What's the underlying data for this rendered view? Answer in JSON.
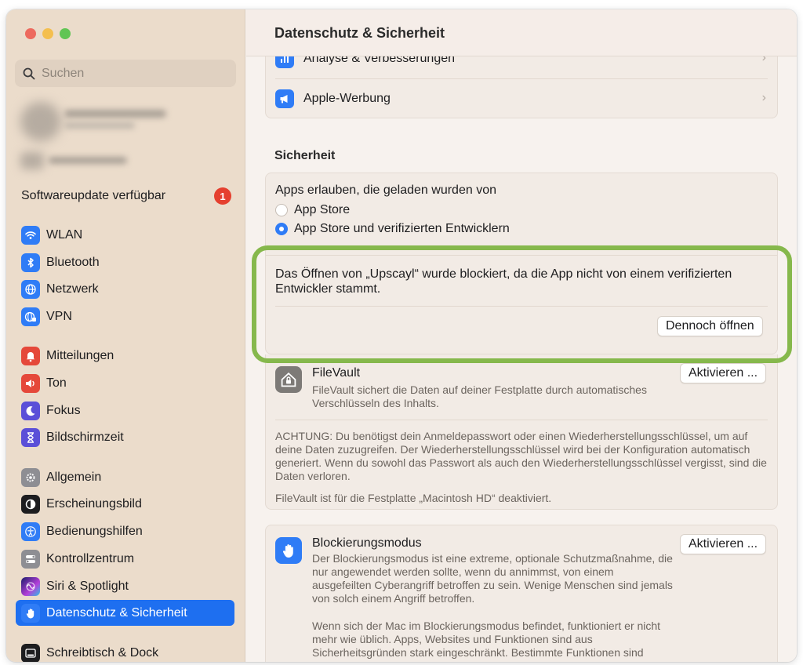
{
  "window": {
    "title": "Datenschutz & Sicherheit"
  },
  "search": {
    "placeholder": "Suchen"
  },
  "sidebar": {
    "update_label": "Softwareupdate verfügbar",
    "update_badge": "1",
    "items": [
      {
        "label": "WLAN",
        "icon": "wifi-icon",
        "color": "#2f7cf6"
      },
      {
        "label": "Bluetooth",
        "icon": "bluetooth-icon",
        "color": "#2f7cf6"
      },
      {
        "label": "Netzwerk",
        "icon": "globe-icon",
        "color": "#2f7cf6"
      },
      {
        "label": "VPN",
        "icon": "vpn-globe-icon",
        "color": "#2f7cf6"
      },
      {
        "label": "Mitteilungen",
        "icon": "bell-icon",
        "color": "#e5483a"
      },
      {
        "label": "Ton",
        "icon": "speaker-icon",
        "color": "#e5483a"
      },
      {
        "label": "Fokus",
        "icon": "moon-icon",
        "color": "#5b4fd8"
      },
      {
        "label": "Bildschirmzeit",
        "icon": "hourglass-icon",
        "color": "#5b4fd8"
      },
      {
        "label": "Allgemein",
        "icon": "gear-icon",
        "color": "#8e8e93"
      },
      {
        "label": "Erscheinungsbild",
        "icon": "appearance-icon",
        "color": "#1d1d1f"
      },
      {
        "label": "Bedienungshilfen",
        "icon": "accessibility-icon",
        "color": "#2f7cf6"
      },
      {
        "label": "Kontrollzentrum",
        "icon": "toggles-icon",
        "color": "#8e8e93"
      },
      {
        "label": "Siri & Spotlight",
        "icon": "siri-icon",
        "color": "#6a3fd1"
      },
      {
        "label": "Datenschutz & Sicherheit",
        "icon": "hand-icon",
        "color": "#2f7cf6"
      },
      {
        "label": "Schreibtisch & Dock",
        "icon": "dock-icon",
        "color": "#1d1d1f"
      }
    ]
  },
  "privacy": {
    "analysis_label": "Analyse & Verbesserungen",
    "ads_label": "Apple-Werbung"
  },
  "security": {
    "title": "Sicherheit",
    "allow_label": "Apps erlauben, die geladen wurden von",
    "options": [
      "App Store",
      "App Store und verifizierten Entwicklern"
    ],
    "selected_option": "App Store und verifizierten Entwicklern",
    "blocked_message": "Das Öffnen von „Upscayl“ wurde blockiert, da die App nicht von einem verifizierten Entwickler stammt.",
    "open_anyway": "Dennoch öffnen"
  },
  "filevault": {
    "title": "FileVault",
    "description": "FileVault sichert die Daten auf deiner Festplatte durch automatisches Verschlüsseln des Inhalts.",
    "activate": "Aktivieren ...",
    "warning": "ACHTUNG: Du benötigst dein Anmeldepasswort oder einen Wiederherstellungsschlüssel, um auf deine Daten zuzugreifen. Der Wiederherstellungsschlüssel wird bei der Konfiguration automatisch generiert. Wenn du sowohl das Passwort als auch den Wiederherstellungsschlüssel vergisst, sind die Daten verloren.",
    "status": "FileVault ist für die Festplatte „Macintosh HD“ deaktiviert."
  },
  "lockdown": {
    "title": "Blockierungsmodus",
    "description": "Der Blockierungsmodus ist eine extreme, optionale Schutzmaßnahme, die nur angewendet werden sollte, wenn du annimmst, von einem ausgefeilten Cyberangriff betroffen zu sein. Wenige Menschen sind jemals von solch einem Angriff betroffen.",
    "description2": "Wenn sich der Mac im Blockierungsmodus befindet, funktioniert er nicht mehr wie üblich. Apps, Websites und Funktionen sind aus Sicherheitsgründen stark eingeschränkt. Bestimmte Funktionen sind",
    "activate": "Aktivieren ..."
  }
}
